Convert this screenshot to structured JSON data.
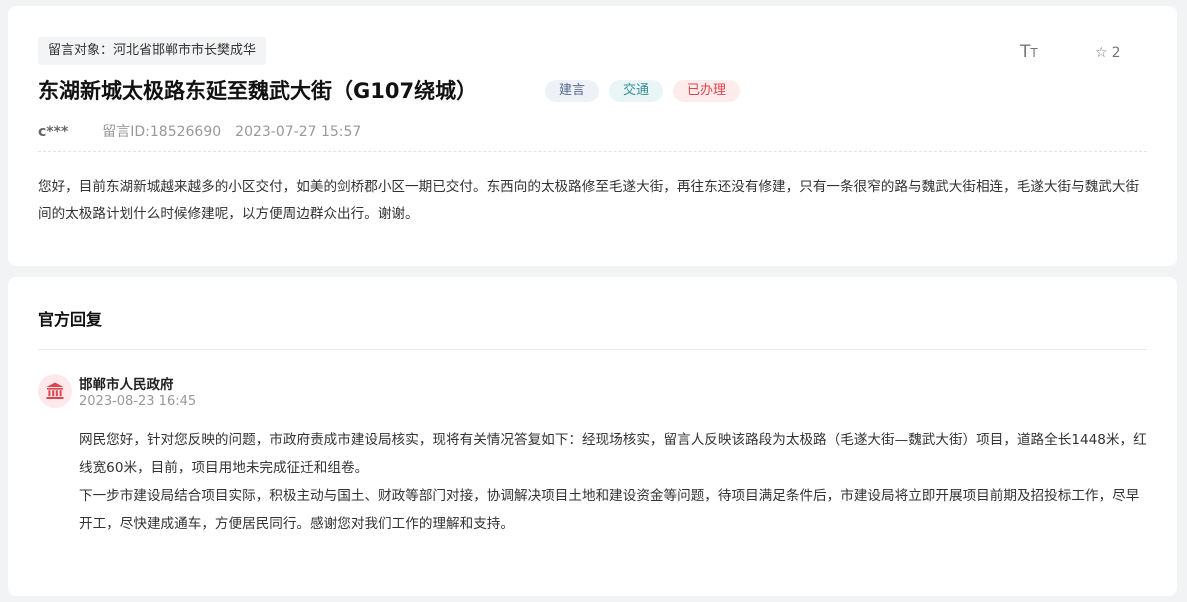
{
  "message": {
    "target_label": "留言对象：",
    "target_value": "河北省邯郸市市长樊成华",
    "title": "东湖新城太极路东延至魏武大街（G107绕城）",
    "badges": [
      "建言",
      "交通",
      "已办理"
    ],
    "font_toggle_label": "TT",
    "favorite_count": "2",
    "author": "c***",
    "message_id": "留言ID:18526690",
    "timestamp": "2023-07-27 15:57",
    "content": "您好，目前东湖新城越来越多的小区交付，如美的剑桥郡小区一期已交付。东西向的太极路修至毛遂大街，再往东还没有修建，只有一条很窄的路与魏武大街相连，毛遂大街与魏武大街间的太极路计划什么时候修建呢，以方便周边群众出行。谢谢。"
  },
  "reply": {
    "section_title": "官方回复",
    "org_name": "邯郸市人民政府",
    "org_icon": "government-building-icon",
    "timestamp": "2023-08-23 16:45",
    "paragraphs": [
      "网民您好，针对您反映的问题，市政府责成市建设局核实，现将有关情况答复如下：经现场核实，留言人反映该路段为太极路（毛遂大街—魏武大街）项目，道路全长1448米，红线宽60米，目前，项目用地未完成征迁和组卷。",
      "下一步市建设局结合项目实际，积极主动与国土、财政等部门对接，协调解决项目土地和建设资金等问题，待项目满足条件后，市建设局将立即开展项目前期及招投标工作，尽早开工，尽快建成通车，方便居民同行。感谢您对我们工作的理解和支持。"
    ]
  },
  "colors": {
    "badge_suggestion": "#5b6b8c",
    "badge_traffic": "#3a8d94",
    "badge_done": "#e0454f",
    "gov_icon": "#e0454f"
  }
}
